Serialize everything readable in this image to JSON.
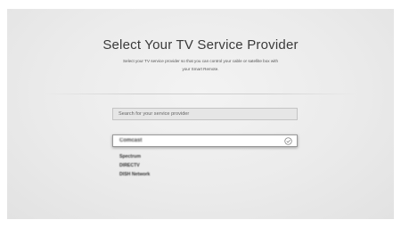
{
  "header": {
    "title": "Select Your TV Service Provider",
    "subtitle_line1": "Select your TV service provider so that you can control your cable or satellite box with",
    "subtitle_line2": "your Smart Remote."
  },
  "search": {
    "placeholder": "Search for your service provider"
  },
  "providers": {
    "selected": "Comcast",
    "items": [
      "Spectrum",
      "DIRECTV",
      "DISH Network"
    ]
  },
  "icons": {
    "selected_indicator": "check-circle-icon"
  },
  "colors": {
    "background": "#ebebeb",
    "title": "#3a3a3a"
  }
}
